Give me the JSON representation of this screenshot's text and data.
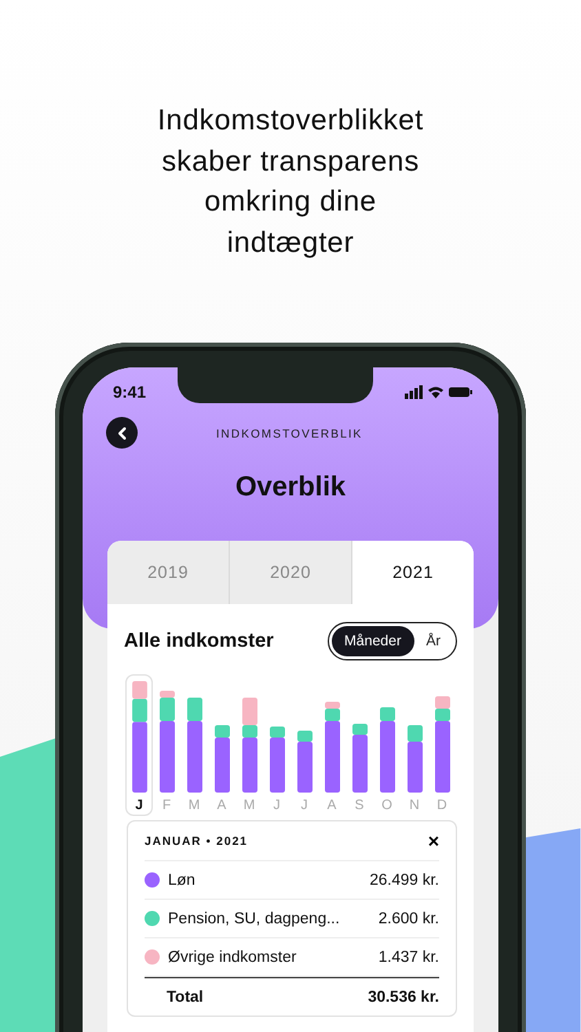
{
  "headline": [
    "Indkomstoverblikket",
    "skaber transparens",
    "omkring dine",
    "indtægter"
  ],
  "status_bar": {
    "time": "9:41"
  },
  "nav": {
    "subtitle": "INDKOMSTOVERBLIK",
    "title": "Overblik"
  },
  "tabs": [
    {
      "label": "2019",
      "selected": false
    },
    {
      "label": "2020",
      "selected": false
    },
    {
      "label": "2021",
      "selected": true
    }
  ],
  "section": {
    "title": "Alle indkomster",
    "toggle": [
      {
        "label": "Måneder",
        "selected": true
      },
      {
        "label": "År",
        "selected": false
      }
    ]
  },
  "months": [
    {
      "label": "J",
      "selected": true
    },
    {
      "label": "F",
      "selected": false
    },
    {
      "label": "M",
      "selected": false
    },
    {
      "label": "A",
      "selected": false
    },
    {
      "label": "M",
      "selected": false
    },
    {
      "label": "J",
      "selected": false
    },
    {
      "label": "J",
      "selected": false
    },
    {
      "label": "A",
      "selected": false
    },
    {
      "label": "S",
      "selected": false
    },
    {
      "label": "O",
      "selected": false
    },
    {
      "label": "N",
      "selected": false
    },
    {
      "label": "D",
      "selected": false
    }
  ],
  "details": {
    "title": "JANUAR • 2021",
    "close": "×",
    "rows": [
      {
        "label": "Løn",
        "value": "26.499 kr.",
        "color": "#9a63ff"
      },
      {
        "label": "Pension, SU, dagpeng...",
        "value": "2.600 kr.",
        "color": "#4fd8b0"
      },
      {
        "label": "Øvrige indkomster",
        "value": "1.437 kr.",
        "color": "#f7b5c2"
      }
    ],
    "total": {
      "label": "Total",
      "value": "30.536 kr."
    }
  }
}
